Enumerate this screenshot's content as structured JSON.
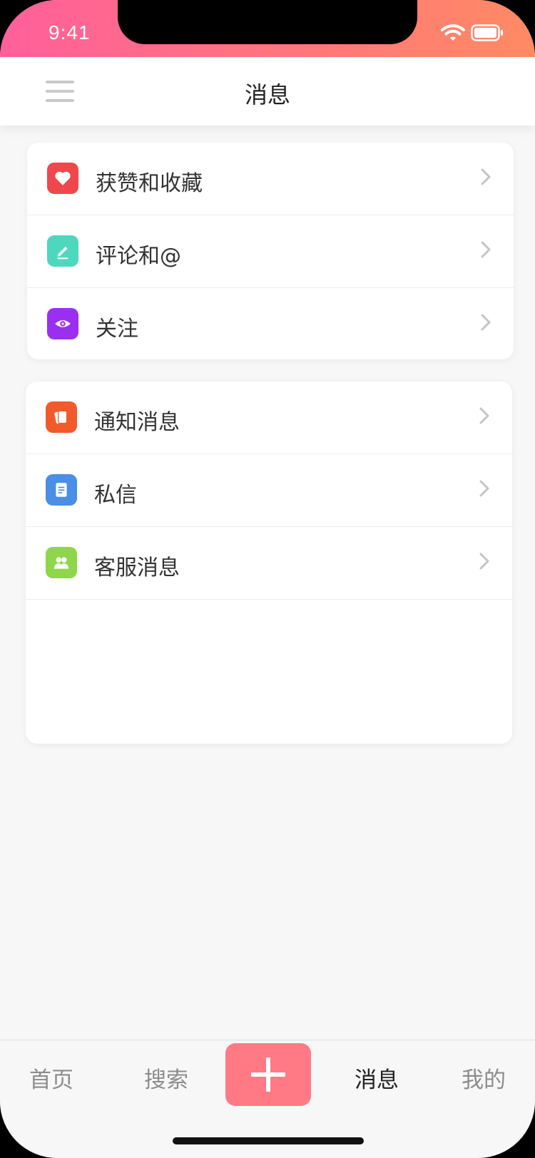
{
  "status": {
    "time": "9:41"
  },
  "header": {
    "title": "消息"
  },
  "groups": [
    {
      "items": [
        {
          "label": "获赞和收藏",
          "icon": "heart-icon",
          "color": "#f0474c"
        },
        {
          "label": "评论和@",
          "icon": "pencil-icon",
          "color": "#4dd8bd"
        },
        {
          "label": "关注",
          "icon": "eye-icon",
          "color": "#9a2ff2"
        }
      ]
    },
    {
      "items": [
        {
          "label": "通知消息",
          "icon": "cards-icon",
          "color": "#f25a2c"
        },
        {
          "label": "私信",
          "icon": "document-icon",
          "color": "#4a8ee6"
        },
        {
          "label": "客服消息",
          "icon": "users-icon",
          "color": "#8fd64a"
        }
      ]
    }
  ],
  "tabbar": {
    "home": "首页",
    "search": "搜索",
    "messages": "消息",
    "me": "我的",
    "add_icon": "plus-icon",
    "accent": "#ff7a85"
  },
  "colors": {
    "status_gradient_start": "#ff5f9a",
    "status_gradient_end": "#ff8a63"
  }
}
